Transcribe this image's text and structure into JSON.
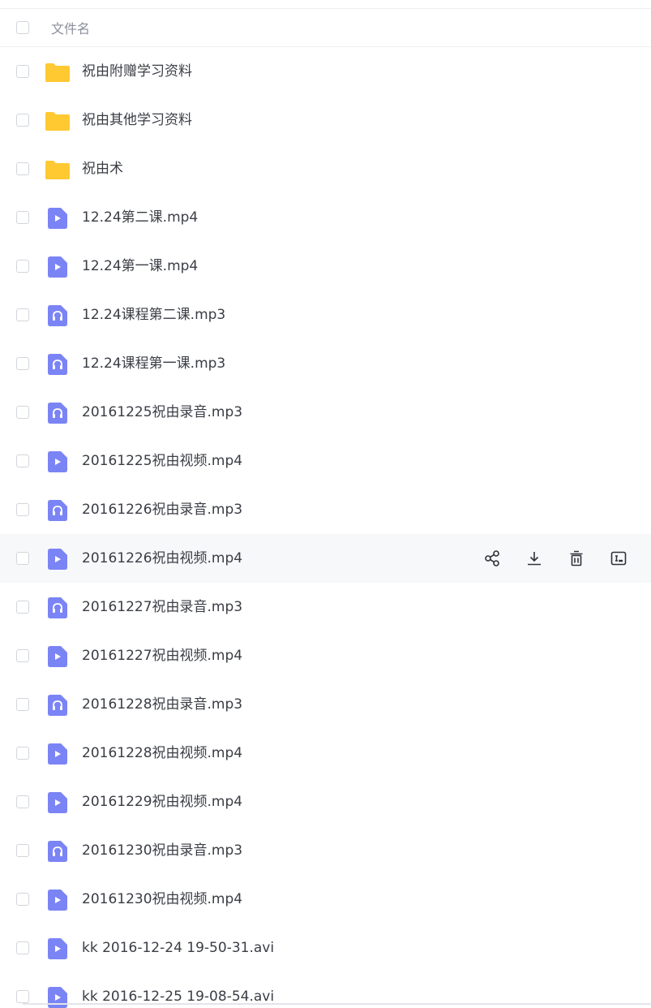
{
  "header": {
    "column_label": "文件名"
  },
  "files": [
    {
      "name": "祝由附赠学习资料",
      "type": "folder"
    },
    {
      "name": "祝由其他学习资料",
      "type": "folder"
    },
    {
      "name": "祝由术",
      "type": "folder"
    },
    {
      "name": "12.24第二课.mp4",
      "type": "video"
    },
    {
      "name": "12.24第一课.mp4",
      "type": "video"
    },
    {
      "name": "12.24课程第二课.mp3",
      "type": "audio"
    },
    {
      "name": "12.24课程第一课.mp3",
      "type": "audio"
    },
    {
      "name": "20161225祝由录音.mp3",
      "type": "audio"
    },
    {
      "name": "20161225祝由视频.mp4",
      "type": "video"
    },
    {
      "name": "20161226祝由录音.mp3",
      "type": "audio"
    },
    {
      "name": "20161226祝由视频.mp4",
      "type": "video",
      "hovered": true
    },
    {
      "name": "20161227祝由录音.mp3",
      "type": "audio"
    },
    {
      "name": "20161227祝由视频.mp4",
      "type": "video"
    },
    {
      "name": "20161228祝由录音.mp3",
      "type": "audio"
    },
    {
      "name": "20161228祝由视频.mp4",
      "type": "video"
    },
    {
      "name": "20161229祝由视频.mp4",
      "type": "video"
    },
    {
      "name": "20161230祝由录音.mp3",
      "type": "audio"
    },
    {
      "name": "20161230祝由视频.mp4",
      "type": "video"
    },
    {
      "name": "kk 2016-12-24 19-50-31.avi",
      "type": "video"
    },
    {
      "name": "kk 2016-12-25 19-08-54.avi",
      "type": "video"
    }
  ],
  "row_actions": [
    {
      "icon": "share-icon"
    },
    {
      "icon": "download-icon"
    },
    {
      "icon": "delete-icon"
    },
    {
      "icon": "rename-icon"
    }
  ],
  "colors": {
    "folder": "#FFC933",
    "media_icon": "#7B84F5",
    "hover_row": "#F7F8FA",
    "text": "#3A3D44",
    "muted": "#8B8F99"
  }
}
